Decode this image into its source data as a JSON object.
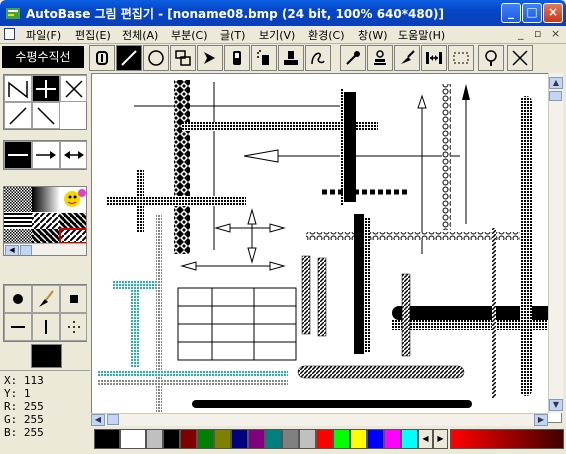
{
  "window": {
    "title": "AutoBase 그림 편집기 - [noname08.bmp (24 bit, 100% 640*480)]"
  },
  "menu": [
    "파일(F)",
    "편집(E)",
    "전체(A)",
    "부분(C)",
    "글(T)",
    "보기(V)",
    "환경(C)",
    "창(W)",
    "도움말(H)"
  ],
  "mdi_controls": [
    "_",
    "▫",
    "×"
  ],
  "toolbar": {
    "mode_label": "수평수직선"
  },
  "status": {
    "x": "X: 113",
    "y": "Y: 1",
    "r": "R: 255",
    "g": "G: 255",
    "b": "B: 255"
  },
  "palette": [
    "#000000",
    "#ffffff",
    "#c0c0c0",
    "#808080",
    "#800000",
    "#008000",
    "#808000",
    "#000080",
    "#800080",
    "#008080",
    "#c0c0c0",
    "#ff0000",
    "#00ff00",
    "#ffff00",
    "#0000ff",
    "#ff00ff"
  ],
  "colors": {
    "title_bar": "#0546c8",
    "fg": "#000000",
    "bg": "#ffffff",
    "cyan_stroke": "#24b4b8"
  }
}
